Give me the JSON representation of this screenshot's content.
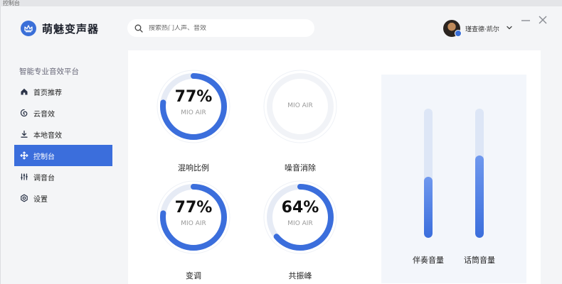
{
  "os": {
    "window_title": "控制台"
  },
  "header": {
    "brand": "萌魅变声器",
    "search": {
      "placeholder": "搜索热门人声、音效",
      "value": ""
    },
    "user": {
      "name": "瑾查德·凯尔"
    }
  },
  "sidebar": {
    "title": "智能专业音效平台",
    "items": [
      {
        "label": "首页推荐",
        "icon": "home-icon",
        "active": false
      },
      {
        "label": "云音效",
        "icon": "cloud-effects-icon",
        "active": false
      },
      {
        "label": "本地音效",
        "icon": "download-icon",
        "active": false
      },
      {
        "label": "控制台",
        "icon": "move-arrows-icon",
        "active": true
      },
      {
        "label": "调音台",
        "icon": "mixer-sliders-icon",
        "active": false
      },
      {
        "label": "设置",
        "icon": "gear-icon",
        "active": false
      }
    ]
  },
  "controls": {
    "dials": [
      {
        "label": "混响比例",
        "value_text": "77%",
        "value": 0.77,
        "subtitle": "MIO AIR",
        "enabled": true
      },
      {
        "label": "噪音消除",
        "value_text": "",
        "value": 0,
        "subtitle": "MIO AIR",
        "enabled": false
      },
      {
        "label": "变调",
        "value_text": "77%",
        "value": 0.77,
        "subtitle": "MIO AIR",
        "enabled": true
      },
      {
        "label": "共振峰",
        "value_text": "64%",
        "value": 0.64,
        "subtitle": "MIO AIR",
        "enabled": true
      }
    ],
    "sliders": [
      {
        "label": "伴奏音量",
        "value": 0.47
      },
      {
        "label": "话筒音量",
        "value": 0.64
      }
    ]
  },
  "colors": {
    "accent": "#3b6edc",
    "accent_light": "#8fb0f0",
    "ring_track": "#e6ebf5"
  }
}
